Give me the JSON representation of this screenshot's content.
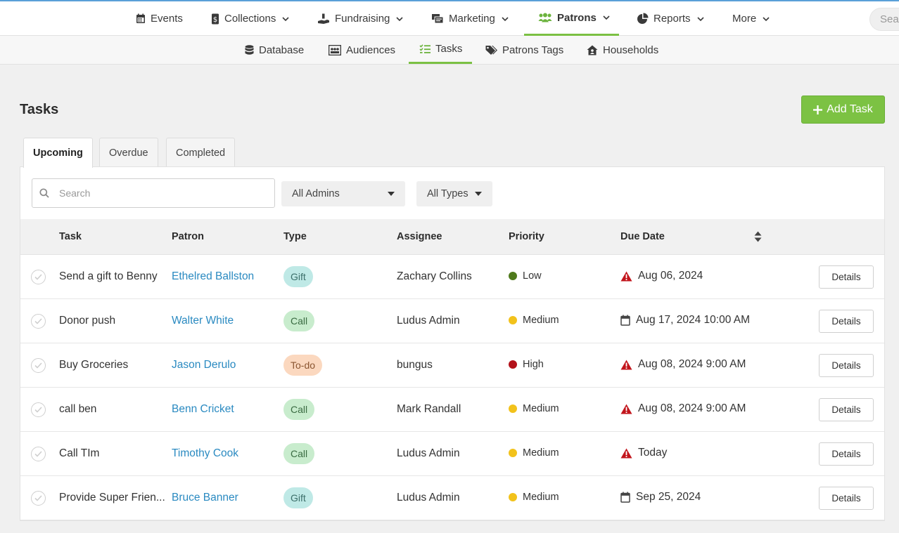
{
  "topnav": {
    "items": [
      {
        "label": "Events",
        "icon": "calendar-icon",
        "dropdown": false
      },
      {
        "label": "Collections",
        "icon": "collections-icon",
        "dropdown": true
      },
      {
        "label": "Fundraising",
        "icon": "donation-hand-icon",
        "dropdown": true
      },
      {
        "label": "Marketing",
        "icon": "marketing-icon",
        "dropdown": true
      },
      {
        "label": "Patrons",
        "icon": "users-icon",
        "dropdown": true,
        "active": true
      },
      {
        "label": "Reports",
        "icon": "pie-chart-icon",
        "dropdown": true
      },
      {
        "label": "More",
        "icon": "",
        "dropdown": true
      }
    ],
    "search_placeholder": "Search"
  },
  "subnav": {
    "items": [
      {
        "label": "Database",
        "icon": "database-icon"
      },
      {
        "label": "Audiences",
        "icon": "audiences-icon"
      },
      {
        "label": "Tasks",
        "icon": "task-list-icon",
        "active": true
      },
      {
        "label": "Patrons Tags",
        "icon": "tags-icon"
      },
      {
        "label": "Households",
        "icon": "house-icon"
      }
    ]
  },
  "page": {
    "title": "Tasks",
    "add_button": "Add Task"
  },
  "tabs": [
    {
      "label": "Upcoming",
      "active": true
    },
    {
      "label": "Overdue"
    },
    {
      "label": "Completed"
    }
  ],
  "filters": {
    "search_placeholder": "Search",
    "admins": "All Admins",
    "types": "All Types"
  },
  "table": {
    "headers": [
      "Task",
      "Patron",
      "Type",
      "Assignee",
      "Priority",
      "Due Date"
    ],
    "rows": [
      {
        "task": "Send a gift to Benny",
        "patron": "Ethelred Ballston",
        "type": "Gift",
        "assignee": "Zachary Collins",
        "priority": "Low",
        "due": "Aug 06, 2024",
        "due_icon": "warning-icon",
        "action": "Details"
      },
      {
        "task": "Donor push",
        "patron": "Walter White",
        "type": "Call",
        "assignee": "Ludus Admin",
        "priority": "Medium",
        "due": "Aug 17, 2024 10:00 AM",
        "due_icon": "calendar-icon",
        "action": "Details"
      },
      {
        "task": "Buy Groceries",
        "patron": "Jason Derulo",
        "type": "To-do",
        "assignee": "bungus",
        "priority": "High",
        "due": "Aug 08, 2024 9:00 AM",
        "due_icon": "warning-icon",
        "action": "Details"
      },
      {
        "task": "call ben",
        "patron": "Benn Cricket",
        "type": "Call",
        "assignee": "Mark Randall",
        "priority": "Medium",
        "due": "Aug 08, 2024 9:00 AM",
        "due_icon": "warning-icon",
        "action": "Details"
      },
      {
        "task": "Call TIm",
        "patron": "Timothy Cook",
        "type": "Call",
        "assignee": "Ludus Admin",
        "priority": "Medium",
        "due": "Today",
        "due_icon": "warning-icon",
        "action": "Details"
      },
      {
        "task": "Provide Super Frien...",
        "patron": "Bruce Banner",
        "type": "Gift",
        "assignee": "Ludus Admin",
        "priority": "Medium",
        "due": "Sep 25, 2024",
        "due_icon": "calendar-icon",
        "action": "Details"
      }
    ]
  },
  "colors": {
    "accent_green": "#7cc243",
    "link_blue": "#2a8ac1",
    "priority_low": "#4f7a1c",
    "priority_medium": "#f2c21b",
    "priority_high": "#b3121a",
    "warning_red": "#c2151c"
  }
}
